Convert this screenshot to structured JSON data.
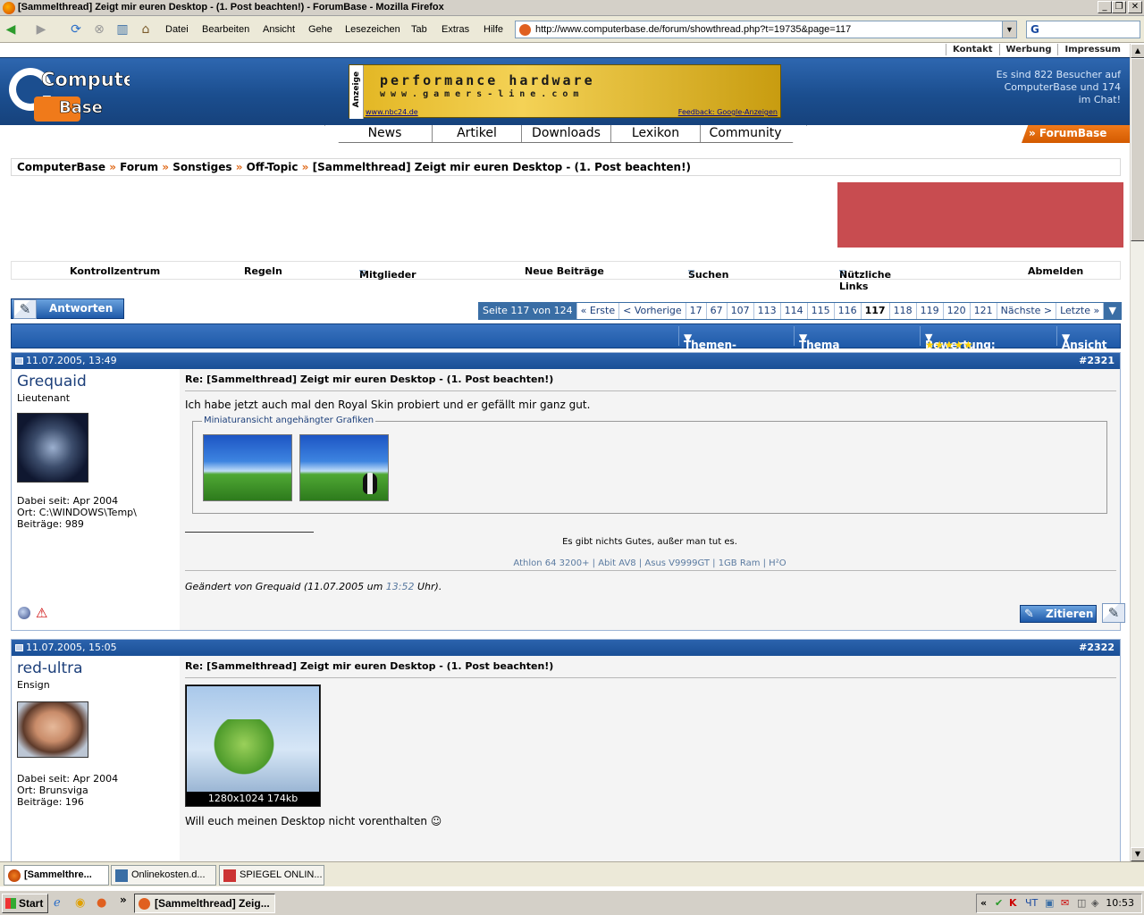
{
  "window": {
    "title": "[Sammelthread] Zeigt mir euren Desktop - (1. Post beachten!) - ForumBase - Mozilla Firefox"
  },
  "menu": [
    "Datei",
    "Bearbeiten",
    "Ansicht",
    "Gehe",
    "Lesezeichen",
    "Tab",
    "Extras",
    "Hilfe"
  ],
  "url": "http://www.computerbase.de/forum/showthread.php?t=19735&page=117",
  "search_logo": "G",
  "toplinks": [
    "Kontakt",
    "Werbung",
    "Impressum"
  ],
  "logo": {
    "line1": "Computer",
    "line2": "Base"
  },
  "ad": {
    "side": "Anzeige",
    "line1": "performance hardware",
    "line2": "www.gamers-line.com",
    "link1": "www.nbc24.de",
    "link2": "Feedback: Google-Anzeigen"
  },
  "visitors": "Es sind 822 Besucher auf ComputerBase und 174 im Chat!",
  "nav": [
    "News",
    "Artikel",
    "Downloads",
    "Lexikon",
    "Community"
  ],
  "forumbase": "» ForumBase",
  "breadcrumb": {
    "items": [
      "ComputerBase",
      "Forum",
      "Sonstiges",
      "Off-Topic"
    ],
    "current": "[Sammelthread] Zeigt mir euren Desktop - (1. Post beachten!)",
    "sep": "»"
  },
  "navbar": {
    "kontrollzentrum": "Kontrollzentrum",
    "regeln": "Regeln",
    "mitglieder": "Mitglieder",
    "neue": "Neue Beiträge",
    "suchen": "Suchen",
    "links": "Nützliche Links",
    "abmelden": "Abmelden"
  },
  "antworten": "Antworten",
  "pager": {
    "label": "Seite 117 von 124",
    "first": "« Erste",
    "prev": "< Vorherige",
    "pages": [
      "17",
      "67",
      "107",
      "113",
      "114",
      "115",
      "116",
      "117",
      "118",
      "119",
      "120",
      "121"
    ],
    "current": "117",
    "next": "Nächste >",
    "last": "Letzte »"
  },
  "threadtools": {
    "options": "Themen-Optionen",
    "search": "Thema durchsuchen",
    "rating": "Bewertung:",
    "stars": "★★★★★",
    "view": "Ansicht"
  },
  "posts": [
    {
      "date": "11.07.2005, 13:49",
      "number": "#2321",
      "username": "Grequaid",
      "rank": "Lieutenant",
      "since": "Dabei seit: Apr 2004",
      "location": "Ort: C:\\WINDOWS\\Temp\\",
      "posts": "Beiträge: 989",
      "title": "Re: [Sammelthread] Zeigt mir euren Desktop - (1. Post beachten!)",
      "body": "Ich habe jetzt auch mal den Royal Skin probiert und er gefällt mir ganz gut.",
      "attachments_legend": "Miniaturansicht angehängter Grafiken",
      "sig1": "Es gibt nichts Gutes, außer man tut es.",
      "sig2": "Athlon 64 3200+ | Abit AV8 | Asus V9999GT | 1GB Ram | H²O",
      "edited_prefix": "Geändert von Grequaid (11.07.2005 um ",
      "edited_time": "13:52",
      "edited_suffix": " Uhr).",
      "quote": "Zitieren"
    },
    {
      "date": "11.07.2005, 15:05",
      "number": "#2322",
      "username": "red-ultra",
      "rank": "Ensign",
      "since": "Dabei seit: Apr 2004",
      "location": "Ort: Brunsviga",
      "posts": "Beiträge: 196",
      "title": "Re: [Sammelthread] Zeigt mir euren Desktop - (1. Post beachten!)",
      "image_caption": "1280x1024 174kb",
      "body": "Will euch meinen Desktop nicht vorenthalten ☺"
    }
  ],
  "browser_tabs": [
    "[Sammelthre...",
    "Onlinekosten.d...",
    "SPIEGEL ONLIN..."
  ],
  "taskbar": {
    "start": "Start",
    "item": "[Sammelthread] Zeig...",
    "clock": "10:53",
    "lang": "ЧТ"
  },
  "colors": {
    "header": "#1b4e8f",
    "accent": "#e06a1a",
    "red_box": "#c84c50"
  }
}
